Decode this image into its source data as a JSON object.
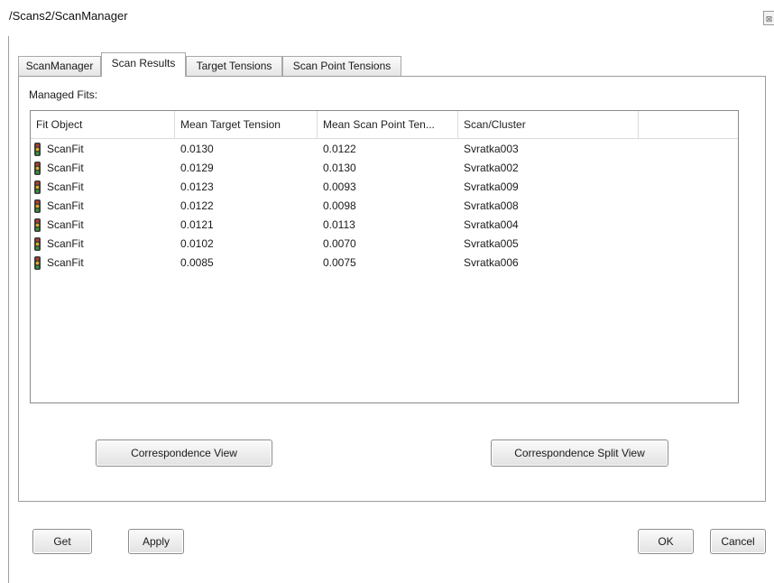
{
  "window": {
    "title": "/Scans2/ScanManager",
    "close_glyph": "⊠"
  },
  "tabs": [
    {
      "label": "ScanManager",
      "active": false
    },
    {
      "label": "Scan Results",
      "active": true
    },
    {
      "label": "Target Tensions",
      "active": false
    },
    {
      "label": "Scan Point Tensions",
      "active": false
    }
  ],
  "scan_results": {
    "managed_fits_label": "Managed Fits:",
    "columns": [
      "Fit Object",
      "Mean Target Tension",
      "Mean Scan Point Ten...",
      "Scan/Cluster"
    ],
    "rows": [
      {
        "icon": "traffic-light-icon",
        "fit_object": "ScanFit",
        "mean_target_tension": "0.0130",
        "mean_scan_point_tension": "0.0122",
        "scan_cluster": "Svratka003"
      },
      {
        "icon": "traffic-light-icon",
        "fit_object": "ScanFit",
        "mean_target_tension": "0.0129",
        "mean_scan_point_tension": "0.0130",
        "scan_cluster": "Svratka002"
      },
      {
        "icon": "traffic-light-icon",
        "fit_object": "ScanFit",
        "mean_target_tension": "0.0123",
        "mean_scan_point_tension": "0.0093",
        "scan_cluster": "Svratka009"
      },
      {
        "icon": "traffic-light-icon",
        "fit_object": "ScanFit",
        "mean_target_tension": "0.0122",
        "mean_scan_point_tension": "0.0098",
        "scan_cluster": "Svratka008"
      },
      {
        "icon": "traffic-light-icon",
        "fit_object": "ScanFit",
        "mean_target_tension": "0.0121",
        "mean_scan_point_tension": "0.0113",
        "scan_cluster": "Svratka004"
      },
      {
        "icon": "traffic-light-icon",
        "fit_object": "ScanFit",
        "mean_target_tension": "0.0102",
        "mean_scan_point_tension": "0.0070",
        "scan_cluster": "Svratka005"
      },
      {
        "icon": "traffic-light-icon",
        "fit_object": "ScanFit",
        "mean_target_tension": "0.0085",
        "mean_scan_point_tension": "0.0075",
        "scan_cluster": "Svratka006"
      }
    ],
    "correspondence_view_label": "Correspondence View",
    "correspondence_split_view_label": "Correspondence Split View"
  },
  "footer": {
    "get_label": "Get",
    "apply_label": "Apply",
    "ok_label": "OK",
    "cancel_label": "Cancel"
  },
  "colors": {
    "border": "#9c9c9c",
    "icon_light_red": "#c0392b",
    "icon_light_yellow": "#e0b020",
    "icon_light_green": "#2e9d3a"
  }
}
